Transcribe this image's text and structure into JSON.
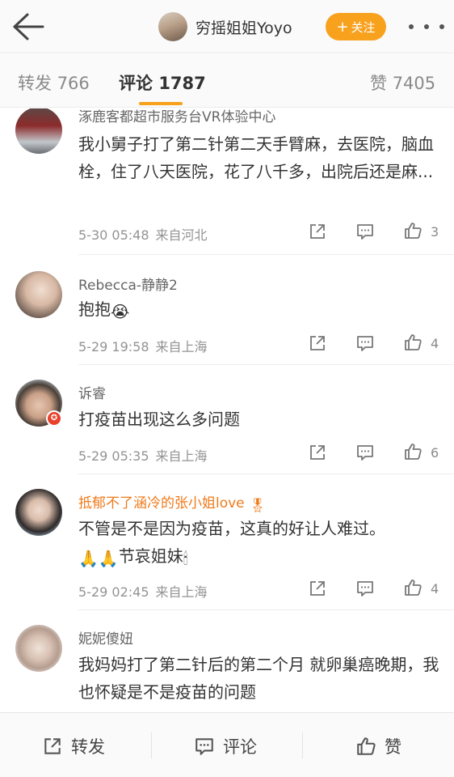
{
  "header": {
    "back_icon": "arrow-left-icon",
    "username": "穷摇姐姐Yoyo",
    "follow_plus": "+",
    "follow_label": "关注",
    "more_icon": "more-dots-icon"
  },
  "tabs": [
    {
      "label": "转发",
      "count": "766"
    },
    {
      "label": "评论",
      "count": "1787"
    },
    {
      "label": "赞",
      "count": "7405"
    }
  ],
  "comments": [
    {
      "name": "涿鹿客都超市服务台VR体验中心",
      "text": "我小舅子打了第二针第二天手臂麻，去医院，脑血栓，住了八天医院，花了八千多，出院后还是麻...",
      "time": "5-30 05:48",
      "source": "来自河北",
      "likes": "3"
    },
    {
      "name": "Rebecca-静静2",
      "text": "抱抱",
      "emoji": "😭",
      "time": "5-29 19:58",
      "source": "来自上海",
      "likes": "4"
    },
    {
      "name": "诉睿",
      "text": "打疫苗出现这么多问题",
      "time": "5-29 05:35",
      "source": "来自上海",
      "likes": "6"
    },
    {
      "name": "抵郁不了涵冷的张小姐love",
      "name_emoji": "🎖",
      "text": "不管是不是因为疫苗，这真的好让人难过。",
      "text2_emoji": "🙏🙏",
      "text2": "节哀姐妹",
      "text2_tail_emoji": "🕯",
      "time": "5-29 02:45",
      "source": "来自上海",
      "likes": "4"
    },
    {
      "name": "妮妮傻妞",
      "text": "我妈妈打了第二针后的第二个月 就卵巢癌晚期，我也怀疑是不是疫苗的问题"
    }
  ],
  "bottom_bar": {
    "repost": "转发",
    "comment": "评论",
    "like": "赞"
  },
  "colors": {
    "accent": "#f7a11d",
    "vip_name": "#ef7a1a"
  }
}
